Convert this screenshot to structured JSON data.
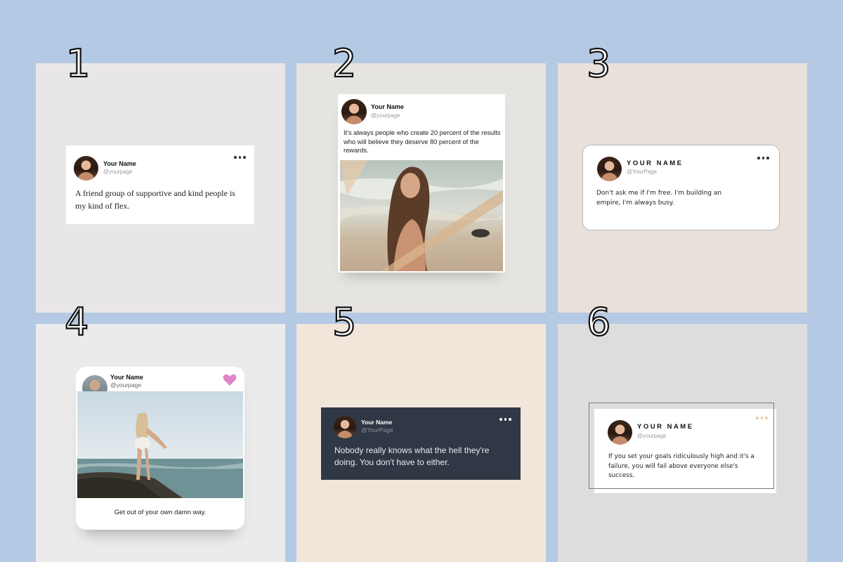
{
  "panels": [
    {
      "number": "1",
      "name": "Your Name",
      "handle": "@yourpage",
      "text": "A friend group of supportive and kind people is my kind of flex."
    },
    {
      "number": "2",
      "name": "Your Name",
      "handle": "@yourpage",
      "text": "It's always people who create 20 percent of the results who will believe they deserve 80 percent of the rewards."
    },
    {
      "number": "3",
      "name": "YOUR NAME",
      "handle": "@YourPage",
      "text": "Don't ask me if I'm free. I'm building an empire, I'm always busy."
    },
    {
      "number": "4",
      "name": "Your Name",
      "handle": "@yourpage",
      "text": "Get out of your own damn way."
    },
    {
      "number": "5",
      "name": "Your Name",
      "handle": "@YourPage",
      "text": "Nobody really knows what the hell they're doing. You don't have to either."
    },
    {
      "number": "6",
      "name": "YOUR NAME",
      "handle": "@yourpage",
      "text": "If you set your goals ridiculously high and it's a failure, you will fail above everyone else's success."
    }
  ],
  "icons": {
    "menu": "more-dots-icon",
    "like": "heart-icon"
  },
  "colors": {
    "background": "#b4c9e3",
    "panel1": "#e8e6e6",
    "panel2": "#e6e4e1",
    "panel3": "#e9e0da",
    "panel4": "#ebebeb",
    "panel5": "#f1e6da",
    "panel6": "#dedddd",
    "dark_card": "#303845",
    "heart": "#de86c9"
  }
}
